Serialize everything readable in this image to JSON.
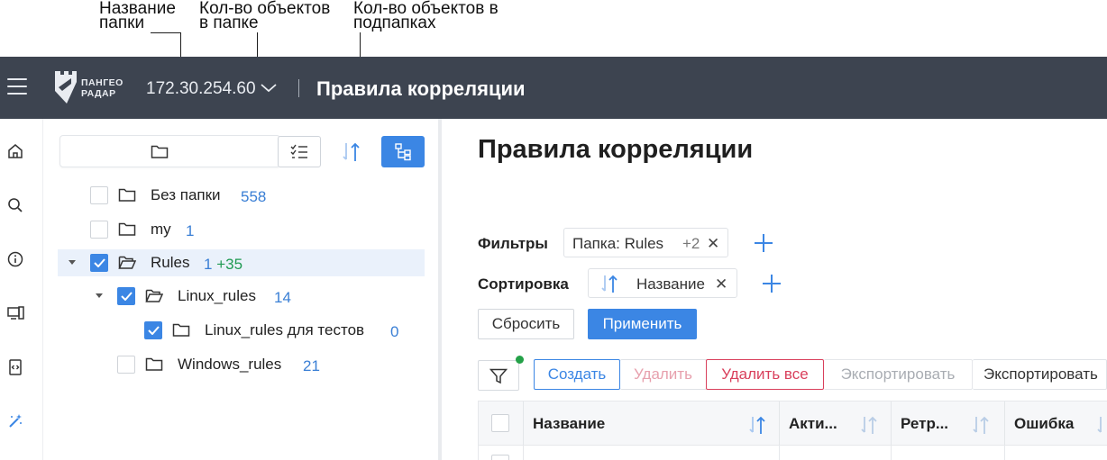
{
  "callouts": {
    "folder_name": "Название\nпапки",
    "objects_in_folder": "Кол-во объектов\nв папке",
    "objects_in_subfolders": "Кол-во объектов в\nподпапках"
  },
  "header": {
    "logo_text": "ПАНГЕО\nРАДАР",
    "host": "172.30.254.60",
    "title": "Правила корреляции"
  },
  "rail": [
    {
      "icon": "home-icon"
    },
    {
      "icon": "search-icon"
    },
    {
      "icon": "info-icon"
    },
    {
      "icon": "devices-icon"
    },
    {
      "icon": "code-file-icon"
    },
    {
      "icon": "magic-wand-icon"
    }
  ],
  "tree": {
    "rows": [
      {
        "label": "Без папки",
        "count": "558",
        "subcount": "",
        "checked": false,
        "expandable": false,
        "level": 0
      },
      {
        "label": "my",
        "count": "1",
        "subcount": "",
        "checked": false,
        "expandable": false,
        "level": 0
      },
      {
        "label": "Rules",
        "count": "1",
        "subcount": "+35",
        "checked": true,
        "expandable": true,
        "level": 0
      },
      {
        "label": "Linux_rules",
        "count": "14",
        "subcount": "",
        "checked": true,
        "expandable": true,
        "level": 1
      },
      {
        "label": "Linux_rules для тестов",
        "count": "0",
        "subcount": "",
        "checked": true,
        "expandable": false,
        "level": 2
      },
      {
        "label": "Windows_rules",
        "count": "21",
        "subcount": "",
        "checked": false,
        "expandable": false,
        "level": 1
      }
    ]
  },
  "main": {
    "title": "Правила корреляции",
    "filters_label": "Фильтры",
    "filter_chip": {
      "text": "Папка: Rules",
      "extra": "+2",
      "close": "✕"
    },
    "sort_label": "Сортировка",
    "sort_chip": {
      "text": "Название",
      "close": "✕"
    },
    "reset": "Сбросить",
    "apply": "Применить",
    "toolbar": {
      "create": "Создать",
      "delete": "Удалить",
      "delete_all": "Удалить все",
      "export_disabled": "Экспортировать",
      "export": "Экспортировать"
    },
    "columns": [
      "Название",
      "Акти...",
      "Ретр...",
      "Ошибка"
    ]
  },
  "colors": {
    "header_bg": "#3d4450",
    "accent": "#3b86e4",
    "danger": "#d9405c",
    "success": "#24a148"
  }
}
